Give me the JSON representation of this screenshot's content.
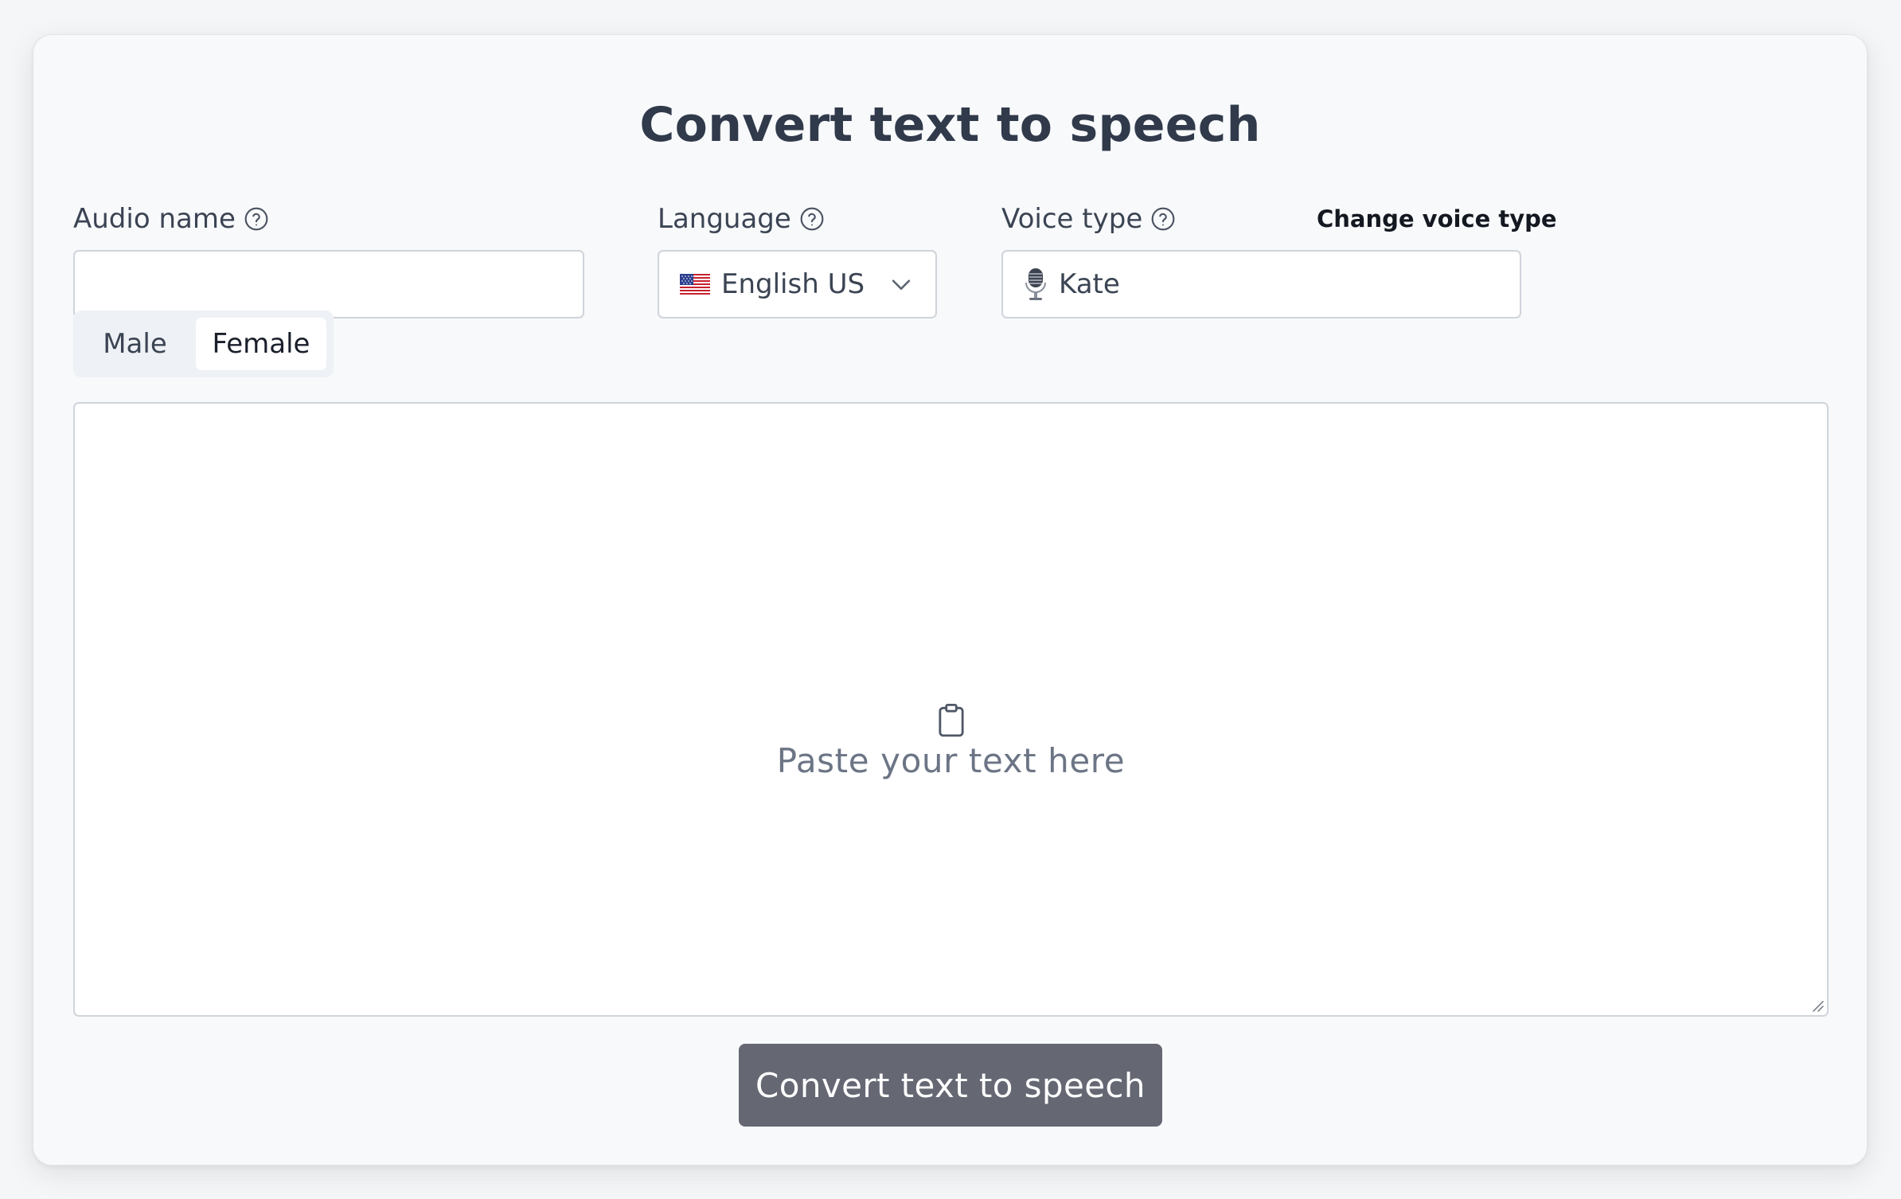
{
  "title": "Convert text to speech",
  "audio_name": {
    "label": "Audio name",
    "value": "",
    "placeholder": ""
  },
  "language": {
    "label": "Language",
    "selected": "English US",
    "flag_icon": "us-flag-icon"
  },
  "voice_type": {
    "label": "Voice type",
    "change_link": "Change voice type",
    "selected": "Kate",
    "icon": "microphone-icon"
  },
  "gender": {
    "options": [
      "Male",
      "Female"
    ],
    "selected": "Female"
  },
  "text_input": {
    "hint": "Paste your text here",
    "value": "",
    "icon": "clipboard-icon"
  },
  "convert_button": {
    "label": "Convert text to speech"
  },
  "colors": {
    "button_bg": "#656873",
    "card_bg": "#f8f9fb",
    "title": "#303a4b",
    "hint": "#6c7585"
  }
}
